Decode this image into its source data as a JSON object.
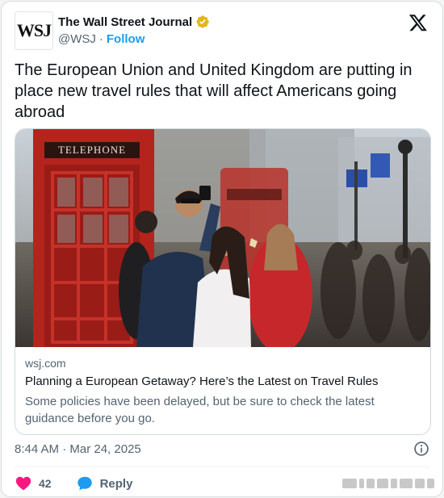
{
  "author": {
    "logo_text": "WSJ",
    "display_name": "The Wall Street Journal",
    "handle": "@WSJ",
    "separator": "·",
    "follow_label": "Follow",
    "verified_badge_color": "#e2b719"
  },
  "tweet": {
    "text": "The European Union and United Kingdom are putting in place new travel rules that will affect Americans going abroad"
  },
  "link_card": {
    "domain": "wsj.com",
    "title": "Planning a European Getaway? Here’s the Latest on Travel Rules",
    "description": "Some policies have been delayed, but be sure to check the latest guidance before you go.",
    "photo_sign": "TELEPHONE"
  },
  "meta": {
    "timestamp": "8:44 AM · Mar 24, 2025"
  },
  "actions": {
    "like_count": "42",
    "reply_label": "Reply",
    "like_color": "#f91880",
    "reply_color": "#1d9bf0"
  },
  "icons": {
    "x_logo": "x-logo-icon",
    "info": "info-icon",
    "heart": "heart-icon",
    "reply": "reply-bubble-icon"
  }
}
